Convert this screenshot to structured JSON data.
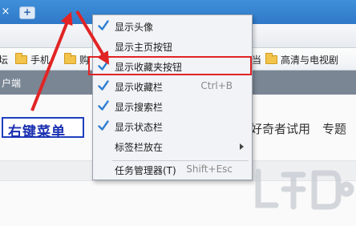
{
  "browser": {
    "tab_close_glyph": "×",
    "new_tab_glyph": "+"
  },
  "bookmarks": [
    {
      "label": "坛"
    },
    {
      "label": "手机"
    },
    {
      "label": "购"
    },
    {
      "label": "当"
    },
    {
      "label": "高清与电视剧"
    }
  ],
  "page": {
    "header_text": "户端",
    "link_1": "好奇者试用",
    "link_2": "专题"
  },
  "menu": {
    "items": [
      {
        "label": "显示头像",
        "checked": true,
        "shortcut": ""
      },
      {
        "label": "显示主页按钮",
        "checked": false,
        "shortcut": ""
      },
      {
        "label": "显示收藏夹按钮",
        "checked": true,
        "shortcut": ""
      },
      {
        "label": "显示收藏栏",
        "checked": true,
        "shortcut": "Ctrl+B"
      },
      {
        "label": "显示搜索栏",
        "checked": true,
        "shortcut": ""
      },
      {
        "label": "显示状态栏",
        "checked": true,
        "shortcut": ""
      },
      {
        "label": "标签栏放在",
        "checked": false,
        "shortcut": "",
        "submenu": true
      },
      {
        "label": "任务管理器(T)",
        "checked": false,
        "shortcut": "Shift+Esc"
      }
    ]
  },
  "annotation": {
    "callout_text": "右键菜单",
    "color_arrow": "#e12424",
    "color_callout": "#1f3fbf"
  },
  "colors": {
    "tabbar": "#3f8fda",
    "check": "#2f7fd2",
    "highlight": "#e12424"
  }
}
